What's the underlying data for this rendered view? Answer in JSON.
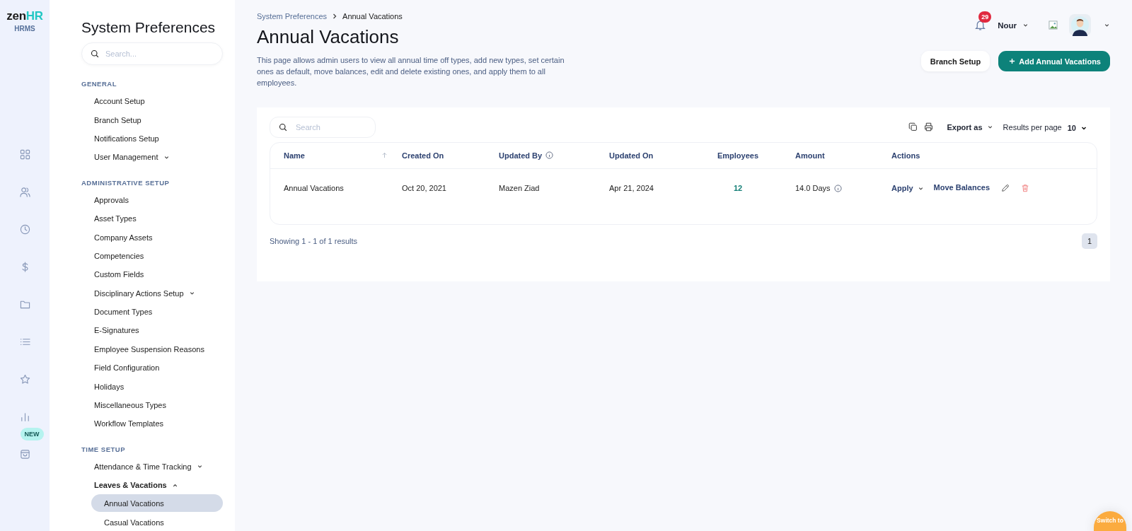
{
  "rail": {
    "logo_main": "zen",
    "logo_accent": "HR",
    "product": "HRMS",
    "new_badge": "NEW"
  },
  "sidebar": {
    "title": "System Preferences",
    "search": {
      "placeholder": "Search..."
    },
    "sections": [
      {
        "title": "GENERAL",
        "items": [
          {
            "label": "Account Setup",
            "kind": "link",
            "selected": false
          },
          {
            "label": "Branch Setup",
            "kind": "link",
            "selected": false
          },
          {
            "label": "Notifications Setup",
            "kind": "link",
            "selected": false
          },
          {
            "label": "User Management",
            "kind": "group",
            "expanded": false,
            "selected": false
          }
        ]
      },
      {
        "title": "ADMINISTRATIVE SETUP",
        "items": [
          {
            "label": "Approvals",
            "kind": "link",
            "selected": false
          },
          {
            "label": "Asset Types",
            "kind": "link",
            "selected": false
          },
          {
            "label": "Company Assets",
            "kind": "link",
            "selected": false
          },
          {
            "label": "Competencies",
            "kind": "link",
            "selected": false
          },
          {
            "label": "Custom Fields",
            "kind": "link",
            "selected": false
          },
          {
            "label": "Disciplinary Actions Setup",
            "kind": "group",
            "expanded": false,
            "selected": false
          },
          {
            "label": "Document Types",
            "kind": "link",
            "selected": false
          },
          {
            "label": "E-Signatures",
            "kind": "link",
            "selected": false
          },
          {
            "label": "Employee Suspension Reasons",
            "kind": "link",
            "selected": false
          },
          {
            "label": "Field Configuration",
            "kind": "link",
            "selected": false
          },
          {
            "label": "Holidays",
            "kind": "link",
            "selected": false
          },
          {
            "label": "Miscellaneous Types",
            "kind": "link",
            "selected": false
          },
          {
            "label": "Workflow Templates",
            "kind": "link",
            "selected": false
          }
        ]
      },
      {
        "title": "TIME SETUP",
        "items": [
          {
            "label": "Attendance & Time Tracking",
            "kind": "group",
            "expanded": false,
            "selected": false
          },
          {
            "label": "Leaves & Vacations",
            "kind": "group",
            "expanded": true,
            "selected": false,
            "children": [
              {
                "label": "Annual Vacations",
                "selected": true
              },
              {
                "label": "Casual Vacations",
                "selected": false
              }
            ]
          }
        ]
      }
    ]
  },
  "header": {
    "breadcrumbs": [
      "System Preferences",
      "Annual Vacations"
    ],
    "title": "Annual Vacations",
    "description": "This page allows admin users to view all annual time off types, add new types, set certain ones as default, move balances, edit and delete existing ones, and apply them to all employees.",
    "notifications": "29",
    "user": "Nour",
    "buttons": [
      {
        "label": "Branch Setup",
        "kind": "secondary"
      },
      {
        "label": "Add Annual Vacations",
        "kind": "primary"
      }
    ]
  },
  "table": {
    "search": {
      "placeholder": "Search"
    },
    "export": "Export as",
    "results_label": "Results per page",
    "results_value": "10",
    "columns": [
      {
        "label": "Name",
        "kind": "sortable"
      },
      {
        "label": "Created On",
        "kind": "plain"
      },
      {
        "label": "Updated By",
        "kind": "info"
      },
      {
        "label": "Updated On",
        "kind": "plain"
      },
      {
        "label": "Employees",
        "kind": "center"
      },
      {
        "label": "Amount",
        "kind": "plain"
      },
      {
        "label": "Actions",
        "kind": "plain"
      }
    ],
    "rows": [
      {
        "name": "Annual Vacations",
        "created_on": "Oct 20, 2021",
        "updated_by": "Mazen Ziad",
        "updated_on": "Apr 21, 2024",
        "employees": "12",
        "amount": "14.0 Days",
        "actions": {
          "apply": "Apply",
          "move": "Move Balances"
        }
      }
    ],
    "summary": "Showing 1 - 1 of 1 results",
    "pages": [
      {
        "label": "1",
        "selected": true
      }
    ]
  },
  "switch_button": "Switch to"
}
